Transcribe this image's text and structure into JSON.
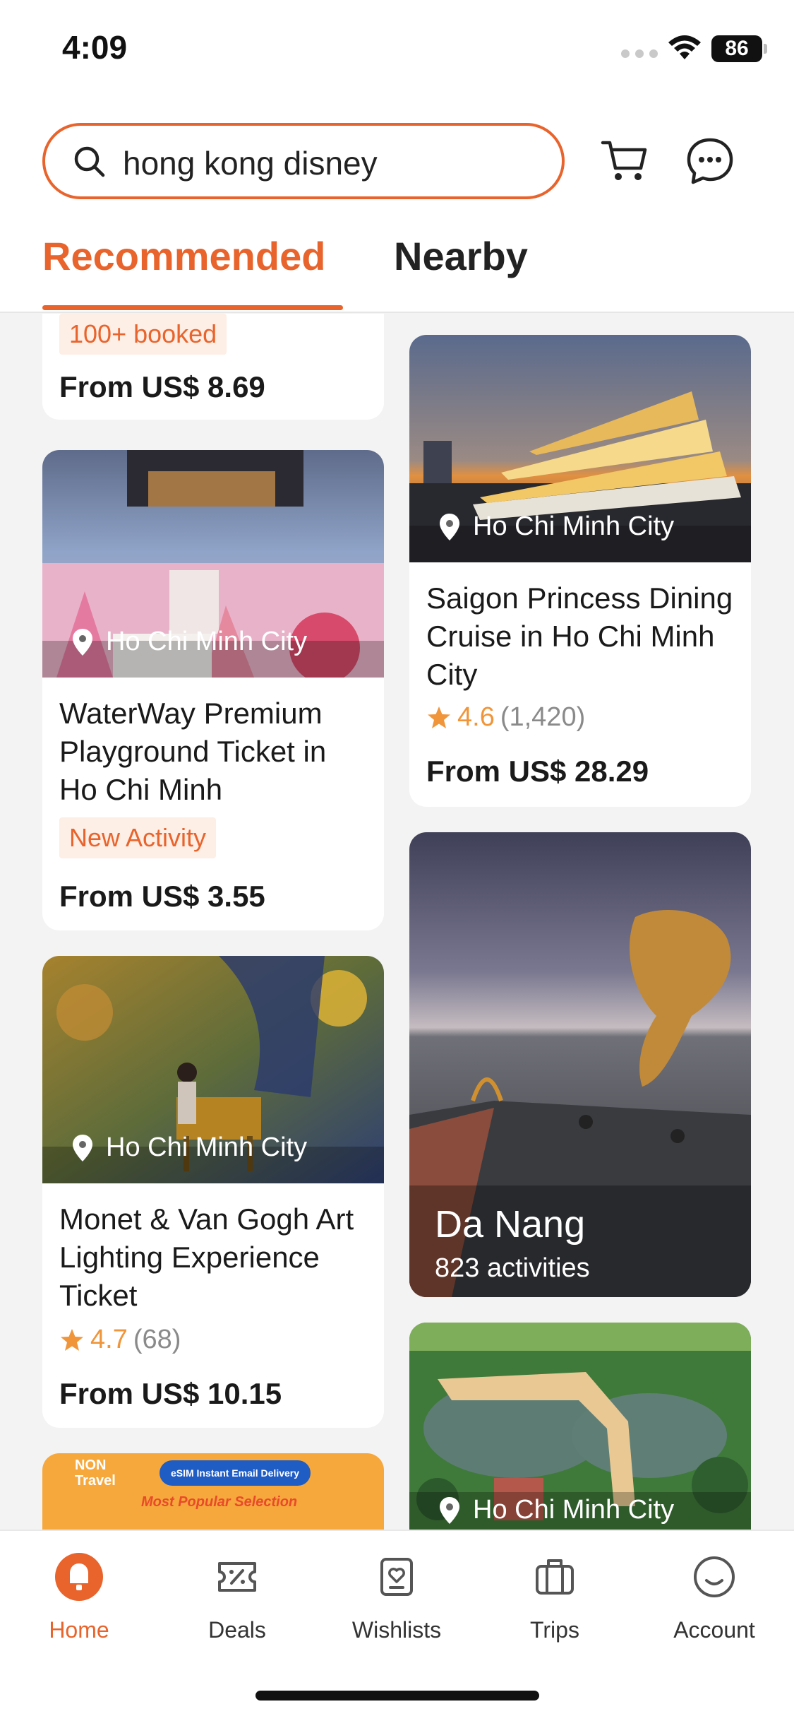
{
  "status": {
    "time": "4:09",
    "battery": "86"
  },
  "search": {
    "query": "hong kong disney"
  },
  "tabs": [
    {
      "label": "Recommended"
    },
    {
      "label": "Nearby"
    }
  ],
  "cards": {
    "partial_top": {
      "badge": "100+ booked",
      "price": "From US$ 8.69"
    },
    "waterway": {
      "location": "Ho Chi Minh City",
      "title": "WaterWay Premium Playground Ticket in Ho Chi Minh",
      "badge": "New Activity",
      "price": "From US$ 3.55"
    },
    "monet": {
      "location": "Ho Chi Minh City",
      "title": "Monet & Van Gogh Art Lighting Experience Ticket",
      "rating": "4.7",
      "reviews": "(68)",
      "price": "From US$ 10.15"
    },
    "saigon": {
      "location": "Ho Chi Minh City",
      "title": "Saigon Princess Dining Cruise in Ho Chi Minh City",
      "rating": "4.6",
      "reviews": "(1,420)",
      "price": "From US$ 28.29"
    },
    "danang": {
      "name": "Da Nang",
      "activities": "823 activities"
    },
    "park": {
      "location": "Ho Chi Minh City"
    },
    "esim": {
      "brand": "NON Travel",
      "tag": "eSIM Instant Email Delivery",
      "promo": "Most Popular Selection"
    }
  },
  "nav": [
    {
      "label": "Home",
      "icon": "home-icon"
    },
    {
      "label": "Deals",
      "icon": "deals-icon"
    },
    {
      "label": "Wishlists",
      "icon": "wishlist-icon"
    },
    {
      "label": "Trips",
      "icon": "trips-icon"
    },
    {
      "label": "Account",
      "icon": "account-icon"
    }
  ],
  "colors": {
    "accent": "#e8642c",
    "rating": "#f0953a"
  }
}
